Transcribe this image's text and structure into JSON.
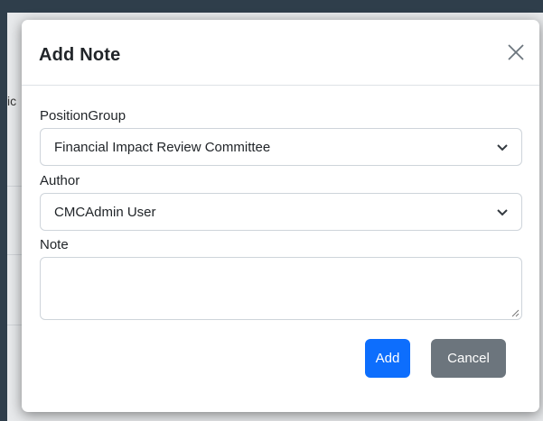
{
  "background_page": {
    "partial_text": "ic"
  },
  "modal": {
    "title": "Add Note",
    "close_icon": "close-icon",
    "fields": {
      "position_group": {
        "label": "PositionGroup",
        "value": "Financial Impact Review Committee"
      },
      "author": {
        "label": "Author",
        "value": "CMCAdmin User"
      },
      "note": {
        "label": "Note",
        "value": ""
      }
    },
    "buttons": {
      "add_label": "Add",
      "cancel_label": "Cancel"
    }
  },
  "colors": {
    "primary": "#0d6efd",
    "secondary": "#6c757d",
    "border": "#ced4da",
    "text": "#212529"
  }
}
